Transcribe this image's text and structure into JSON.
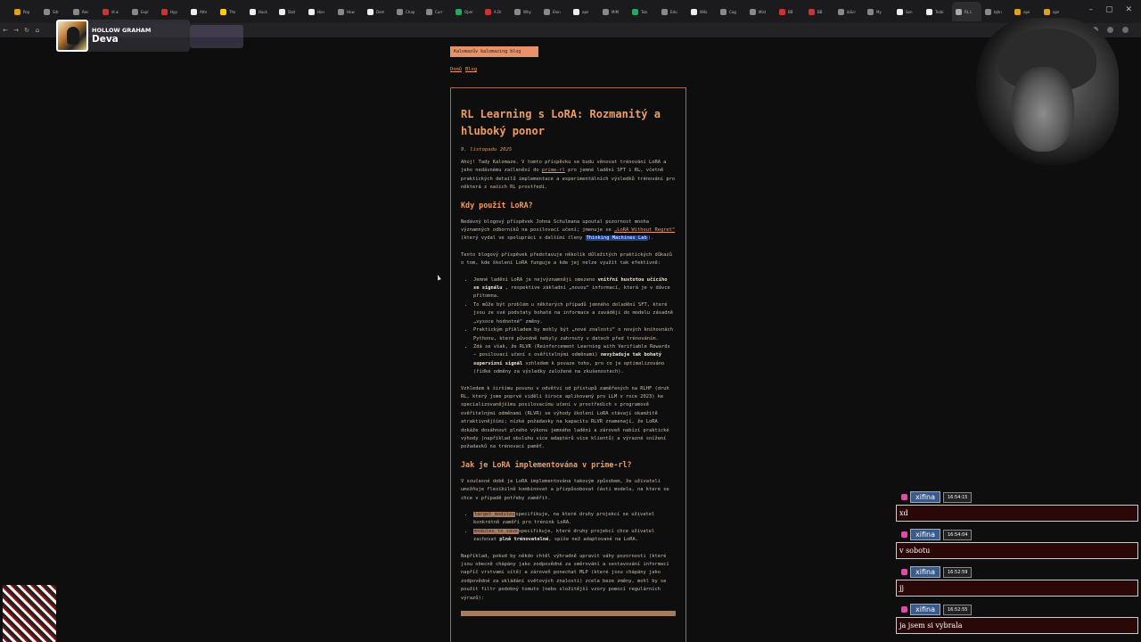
{
  "browser": {
    "tabs": [
      {
        "title": "Pop",
        "color": "#e0a020"
      },
      {
        "title": "Sdr",
        "color": "#888888"
      },
      {
        "title": "Res",
        "color": "#888888"
      },
      {
        "title": "dl ai",
        "color": "#c33"
      },
      {
        "title": "Expl",
        "color": "#888888"
      },
      {
        "title": "Hyp",
        "color": "#cc3333"
      },
      {
        "title": "Attn",
        "color": "#eeeeee"
      },
      {
        "title": "The",
        "color": "#ffcc00"
      },
      {
        "title": "Hack",
        "color": "#eeeeee"
      },
      {
        "title": "Stat",
        "color": "#eeeeee"
      },
      {
        "title": "Hier",
        "color": "#eeeeee"
      },
      {
        "title": "How",
        "color": "#888888"
      },
      {
        "title": "Dem",
        "color": "#eeeeee"
      },
      {
        "title": "Chap",
        "color": "#888888"
      },
      {
        "title": "Curr",
        "color": "#888888"
      },
      {
        "title": "Oper",
        "color": "#20aa60"
      },
      {
        "title": "A Dr",
        "color": "#cc3333"
      },
      {
        "title": "Why",
        "color": "#888888"
      },
      {
        "title": "Elon",
        "color": "#888888"
      },
      {
        "title": "ope",
        "color": "#eeeeee"
      },
      {
        "title": "MiM",
        "color": "#888888"
      },
      {
        "title": "Tub",
        "color": "#20aa60"
      },
      {
        "title": "Edu",
        "color": "#888888"
      },
      {
        "title": "Wiki",
        "color": "#eeeeee"
      },
      {
        "title": "Cog",
        "color": "#888888"
      },
      {
        "title": "Mist",
        "color": "#888888"
      },
      {
        "title": "BB",
        "color": "#cc3333"
      },
      {
        "title": "BB",
        "color": "#cc3333"
      },
      {
        "title": "ibScr",
        "color": "#888888"
      },
      {
        "title": "My",
        "color": "#888888"
      },
      {
        "title": "Sen",
        "color": "#eeeeee"
      },
      {
        "title": "Trebi",
        "color": "#eeeeee"
      },
      {
        "title": "RL L",
        "color": "#aaaaaa"
      },
      {
        "title": "Iqhn",
        "color": "#888888"
      },
      {
        "title": "ope",
        "color": "#e0a020"
      },
      {
        "title": "ope",
        "color": "#e0a020"
      }
    ],
    "url": "kalo",
    "window_controls": [
      "–",
      "▢",
      "✕"
    ]
  },
  "now_playing": {
    "artist": "HOLLOW GRAHAM",
    "title": "Deva"
  },
  "page": {
    "blog_badge": "Kalomazův kalomazing blog",
    "breadcrumb": [
      "Domů",
      "Blog"
    ],
    "title": "RL Learning s LoRA: Rozmanitý a hluboký ponor",
    "date": "9. listopadu 2025",
    "intro_1": "Ahoj! Tady Kalomaze. V tomto příspěvku se budu věnovat trénování LoRA a jeho nedávnému začlenění do ",
    "intro_link": "prime-rl",
    "intro_2": " pro jemné ladění SFT i RL, včetně praktických detailů implementace a experimentálních výsledků trénování pro některá z našich RL prostředí.",
    "h_when": "Kdy použít LoRA?",
    "when_1": "Nedávný blogový příspěvek Johna Schulmana upoutal pozornost mnoha významných odborníků na posilovací učení; jmenuje se ",
    "when_link": "„LoRA Without Regret“",
    "when_2": " (který vydal ve spolupráci s dalšími členy ",
    "when_hl": "Thinking Machines Lab",
    "when_3": ").",
    "points_intro": "Tento blogový příspěvek představuje několik důležitých praktických důkazů o tom, kde školení LoRA funguje a kde jej nelze využít tak efektivně:",
    "b1_a": "Jemné ladění LoRA je nejvýznamněji omezeno ",
    "b1_b": "vnitřní hustotou učícího se signálu",
    "b1_c": " , respektive základní „novou“ informací, která je v dávce přítomna.",
    "b2": "To může být problém u některých případů jemného doladění SFT, které jsou ze své podstaty bohaté na informace a zavádějí do modelu zásadně „vysoce hodnotné“ změny.",
    "b3": "Praktickým příkladem by mohly být „nové znalosti“ o nových knihovnách Pythonu, které původně nebyly zahrnuty v datech před trénováním.",
    "b4_a": "Zdá se však, že RLVR (Reinforcement Learning with Verifiable Rewards – posilovací učení s ověřitelnými odměnami) ",
    "b4_b": "nevyžaduje tak bohatý supervizní signál",
    "b4_c": " vzhledem k povaze toho, pro co je optimalizováno (řídké odměny za výsledky založené na zkušenostech).",
    "para_rlhf": "Vzhledem k širšímu posunu v odvětví od přístupů zaměřených na RLHF (druh RL, který jsme poprvé viděli široce aplikovaný pro LLM v roce 2023) ke specializovanějšímu posilovacímu učení v prostředích s programově ověřitelnými odměnami (RLVR) se výhody školení LoRA stávají okamžitě atraktivnějšími; nízké požadavky na kapacitu RLVR znamenají, že LoRA dokáže dosáhnout plného výkonu jemného ladění a zároveň nabízí praktické výhody (například obsluhu více adaptérů více klientů) a výrazné snížení požadavků na trénovací paměť.",
    "h_impl": "Jak je LoRA implementována v prime-rl?",
    "impl_intro": "V současné době je LoRA implementována takovým způsobem, že uživateli umožňuje flexibilně kombinovat a přizpůsobovat části modelu, na které se chce v případě potřeby zaměřit.",
    "i1_code": "target_modules",
    "i1_text": "specifikuje, na které druhy projekcí se uživatel konkrétně zaměří pro trénink LoRA.",
    "i2_code": "modules_to_save",
    "i2_text_a": "specifikuje, které druhy projekcí chce uživatel zachovat ",
    "i2_text_b": "plně trénovatelné",
    "i2_text_c": ", spíše než adaptované na LoRA.",
    "para_end": "Například, pokud by někdo chtěl výhradně upravit váhy pozornosti (které jsou obecně chápány jako zodpovědné za směrování a sestavování informací napříč vrstvami sítě) a zároveň ponechat MLP (které jsou chápány jako zodpovědné za ukládání světových znalostí) zcela beze změny, mohl by se použít filtr podobný tomuto (nebo složitější vzory pomocí regulárních výrazů):"
  },
  "chat": [
    {
      "user": "xifina",
      "time": "16:54:15",
      "text": "xd"
    },
    {
      "user": "xifina",
      "time": "16:54:04",
      "text": "v sobotu"
    },
    {
      "user": "xifina",
      "time": "16:52:59",
      "text": "jj"
    },
    {
      "user": "xifina",
      "time": "16:52:55",
      "text": "ja jsem si vybrala"
    }
  ]
}
